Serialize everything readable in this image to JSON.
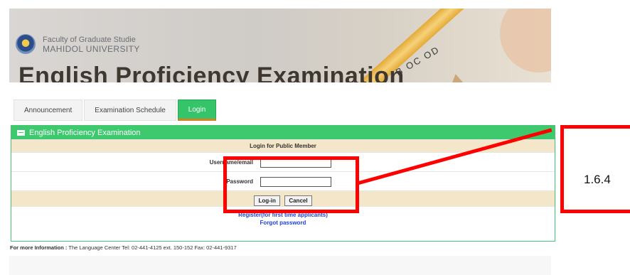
{
  "banner": {
    "faculty_line1": "Faculty of Graduate Studie",
    "faculty_line2": "MAHIDOL UNIVERSITY",
    "title": "English Proficiency Examination",
    "bubbles": "B OC OD"
  },
  "tabs": [
    {
      "label": "Announcement",
      "active": false
    },
    {
      "label": "Examination Schedule",
      "active": false
    },
    {
      "label": "Login",
      "active": true
    }
  ],
  "panel": {
    "title": "English Proficiency Examination",
    "form_title": "Login for Public Member",
    "username_label": "Username/email",
    "password_label": "Password",
    "login_button": "Log-in",
    "cancel_button": "Cancel",
    "register_link": "Register(for first time applicants)",
    "forgot_link": "Forgot password"
  },
  "footer": {
    "more_info_label": "For more Information :",
    "more_info_text": " The Language Center Tel: 02-441-4125 ext. 150-152 Fax: 02-441-9317"
  },
  "annotation": {
    "label": "1.6.4",
    "color": "#ff0000"
  },
  "colors": {
    "accent_green": "#3ec96f",
    "row_beige": "#f4e6c8",
    "link_blue": "#1f3fd6"
  }
}
